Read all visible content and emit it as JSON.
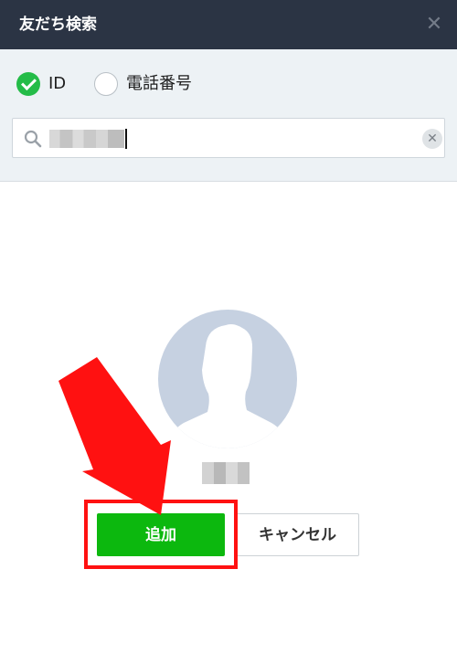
{
  "dialog": {
    "title": "友だち検索",
    "close_glyph": "✕"
  },
  "search_type": {
    "options": [
      {
        "label": "ID",
        "selected": true
      },
      {
        "label": "電話番号",
        "selected": false
      }
    ]
  },
  "search": {
    "value": "",
    "clear_glyph": "✕"
  },
  "result": {
    "avatar_icon": "default-person-silhouette-icon",
    "add_label": "追加",
    "cancel_label": "キャンセル"
  },
  "colors": {
    "header": "#2b3444",
    "panel": "#edf2f5",
    "accent_green": "#0cb80e",
    "check_green": "#24bc48",
    "avatar": "#c6d1e1",
    "annotation_red": "#ff1111"
  }
}
